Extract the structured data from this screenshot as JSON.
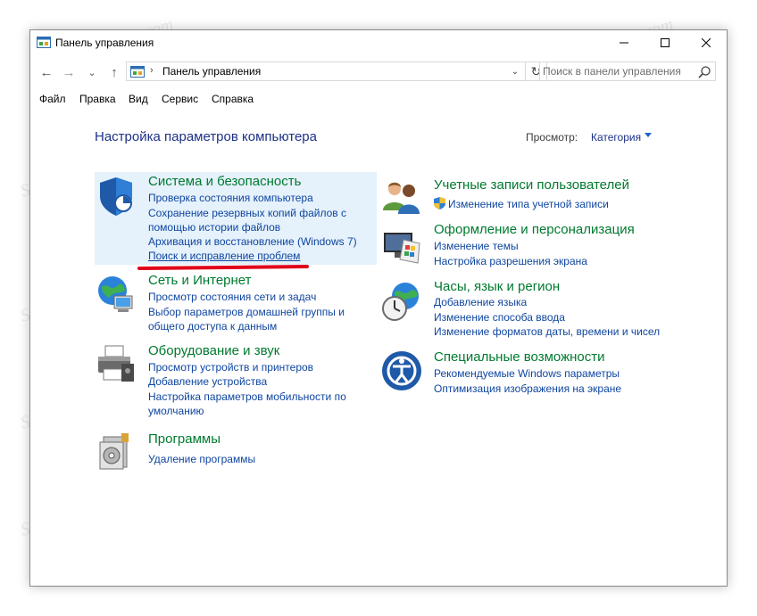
{
  "window": {
    "title": "Панель управления"
  },
  "address_bar": {
    "path": "Панель управления",
    "separator": "›",
    "dropdown_glyph": "⌄",
    "refresh_glyph": "↻"
  },
  "nav": {
    "back": "←",
    "forward": "→",
    "recent": "⌄",
    "up": "↑"
  },
  "search": {
    "placeholder": "Поиск в панели управления"
  },
  "menu": [
    "Файл",
    "Правка",
    "Вид",
    "Сервис",
    "Справка"
  ],
  "main": {
    "heading": "Настройка параметров компьютера",
    "view_label": "Просмотр:",
    "view_value": "Категория"
  },
  "categories": {
    "system": {
      "icon": "shield-icon",
      "title": "Система и безопасность",
      "links": [
        "Проверка состояния компьютера",
        "Сохранение резервных копий файлов с",
        "помощью истории файлов",
        "Архивация и восстановление (Windows 7)",
        "Поиск и исправление проблем"
      ]
    },
    "network": {
      "icon": "network-globe-icon",
      "title": "Сеть и Интернет",
      "links": [
        "Просмотр состояния сети и задач",
        "Выбор параметров домашней группы и",
        "общего доступа к данным"
      ]
    },
    "hardware": {
      "icon": "printer-icon",
      "title": "Оборудование и звук",
      "links": [
        "Просмотр устройств и принтеров",
        "Добавление устройства",
        "Настройка параметров мобильности по",
        "умолчанию"
      ]
    },
    "programs": {
      "icon": "programs-icon",
      "title": "Программы",
      "links": [
        "Удаление программы"
      ]
    },
    "accounts": {
      "icon": "users-icon",
      "title": "Учетные записи пользователей",
      "links": [
        "Изменение типа учетной записи"
      ]
    },
    "appearance": {
      "icon": "display-palette-icon",
      "title": "Оформление и персонализация",
      "links": [
        "Изменение темы",
        "Настройка разрешения экрана"
      ]
    },
    "clock": {
      "icon": "clock-globe-icon",
      "title": "Часы, язык и регион",
      "links": [
        "Добавление языка",
        "Изменение способа ввода",
        "Изменение форматов даты, времени и чисел"
      ]
    },
    "access": {
      "icon": "ease-of-access-icon",
      "title": "Специальные возможности",
      "links": [
        "Рекомендуемые Windows параметры",
        "Оптимизация изображения на экране"
      ]
    }
  },
  "watermark": "Soringpcrepair.com",
  "colors": {
    "category_title": "#007a2f",
    "link": "#0f46a0",
    "heading": "#1e3287",
    "highlight": "#e5f1fb",
    "annotation": "#e0001b"
  }
}
